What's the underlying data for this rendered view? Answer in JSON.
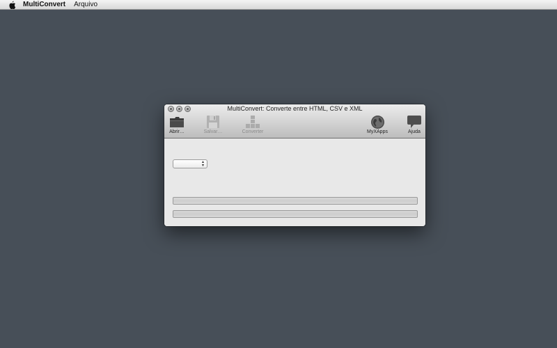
{
  "menubar": {
    "app_name": "MultiConvert",
    "menus": [
      "Arquivo"
    ]
  },
  "window": {
    "title": "MultiConvert: Converte entre HTML, CSV e XML",
    "toolbar": {
      "open_label": "Abrir…",
      "save_label": "Salvar…",
      "convert_label": "Converter",
      "myxapps_label": "MyXApps",
      "help_label": "Ajuda"
    },
    "format_select": {
      "value": ""
    },
    "progress": [
      0,
      0
    ]
  }
}
